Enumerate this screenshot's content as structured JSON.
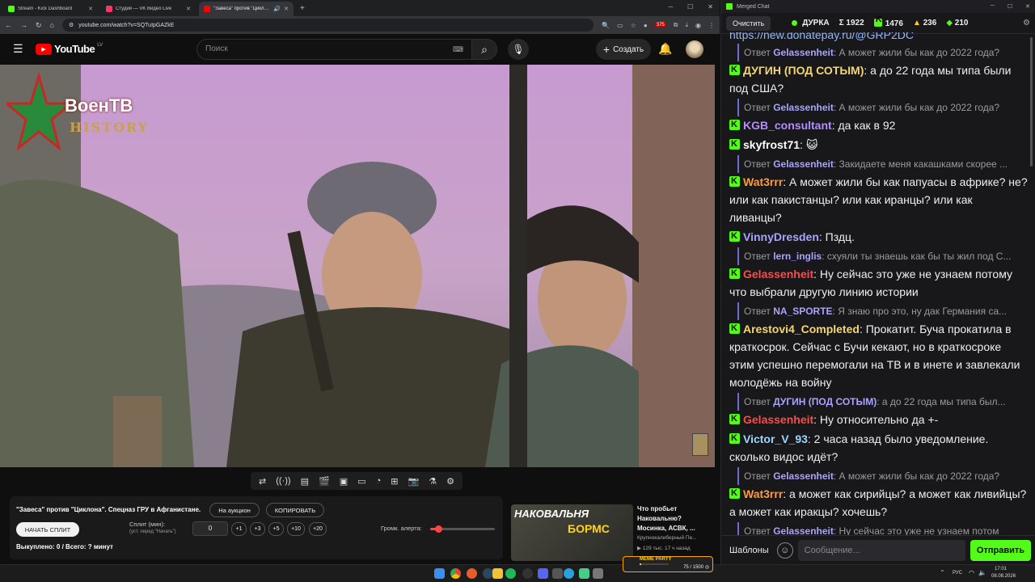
{
  "browser": {
    "tabs": [
      {
        "label": "Stream - Kick Dashboard",
        "color": "#53fc18"
      },
      {
        "label": "Студия — VK Видео Live",
        "color": "#ff3366"
      },
      {
        "label": "\"Завеса\" против \"Циклона\"...",
        "color": "#ff0000"
      }
    ],
    "url": "youtube.com/watch?v=SQTuIpGAZkE",
    "ext_badge": "375"
  },
  "youtube": {
    "logo": "YouTube",
    "region": "LV",
    "search_placeholder": "Поиск",
    "create_label": "Создать"
  },
  "video": {
    "watermark_line1": "ВоенТВ",
    "watermark_line2": "HISTORY"
  },
  "panel": {
    "title": "\"Завеса\" против \"Циклона\". Спецназ ГРУ в Афганистане.",
    "auction_label": "На аукцион",
    "copy_label": "КОПИРОВАТЬ",
    "start_split_label": "НАЧАТЬ СПЛИТ",
    "split_label": "Сплит (мин):",
    "split_hint": "(уст. перед \"Начать\")",
    "split_value": "0",
    "steps": [
      "+1",
      "+3",
      "+5",
      "+10",
      "+20"
    ],
    "alert_volume_label": "Громк. алерта:",
    "alert_volume": 0.12,
    "bought_label": "Выкуплено: 0 / Всего: ? минут"
  },
  "recommendation": {
    "thumb_text_1": "НАКОВАЛЬНЯ",
    "thumb_text_2": "БОРМС",
    "title": "Что пробьет Наковальню? Мосинка, АСВК, ...",
    "channel": "Крупнокалиберный Пе...",
    "meta": "▶ 129 тыс.   17 ч назад"
  },
  "taskbar": {
    "meme_label": "MEME PARTY",
    "meme_count": "75 / 1500 ◎",
    "lang": "РУС",
    "time": "17:01",
    "date": "08.08.2026"
  },
  "chat": {
    "window_title": "Merged Chat",
    "clear_label": "Очистить",
    "streamer": "ДУРКА",
    "stats": {
      "total": "Σ 1922",
      "kick": "1476",
      "other1": "236",
      "other2": "210"
    },
    "top_line": "https://new.donatepay.ru/@GRP2DC",
    "items": [
      {
        "type": "reply",
        "prefix": "Ответ",
        "user": "Gelassenheit",
        "text": ": А может жили бы как до 2022 года?"
      },
      {
        "type": "msg",
        "user": "ДУГИН (ПОД СОТЫМ)",
        "color": "#f5d76e",
        "text": ": а до 22 года мы типа были под США?"
      },
      {
        "type": "reply",
        "prefix": "Ответ",
        "user": "Gelassenheit",
        "text": ": А может жили бы как до 2022 года?"
      },
      {
        "type": "msg",
        "user": "KGB_consultant",
        "color": "#b48cff",
        "text": ": да как в 92"
      },
      {
        "type": "msg",
        "user": "skyfrost71",
        "color": "#ffffff",
        "text": ": 😺"
      },
      {
        "type": "reply",
        "prefix": "Ответ",
        "user": "Gelassenheit",
        "text": ": Закидаете меня какашками скорее ..."
      },
      {
        "type": "msg",
        "user": "Wat3rrr",
        "color": "#ff9a3c",
        "text": ": А может жили бы как папуасы в африке? не? или как пакистанцы? или как иранцы? или как ливанцы?"
      },
      {
        "type": "msg",
        "user": "VinnyDresden",
        "color": "#a9a4ff",
        "text": ": Пздц."
      },
      {
        "type": "reply",
        "prefix": "Ответ",
        "user": "lern_inglis",
        "text": ": схуяли ты знаешь как бы ты жил под С..."
      },
      {
        "type": "msg",
        "user": "Gelassenheit",
        "color": "#ff4a4a",
        "text": ": Ну сейчас это уже не узнаем потому что выбрали другую линию истории"
      },
      {
        "type": "reply",
        "prefix": "Ответ",
        "user": "NA_SPORTE",
        "text": ": Я знаю про это, ну дак Германия са..."
      },
      {
        "type": "msg",
        "user": "Arestovi4_Completed",
        "color": "#f5d76e",
        "text": ": Прокатит. Буча прокатила в краткосрок. Сейчас с Бучи кекают, но в краткосроке этим успешно перемогали на ТВ и в инете и завлекали молодёжь на войну"
      },
      {
        "type": "reply",
        "prefix": "Ответ",
        "user": "ДУГИН (ПОД СОТЫМ)",
        "text": ": а до 22 года мы типа был..."
      },
      {
        "type": "msg",
        "user": "Gelassenheit",
        "color": "#ff4a4a",
        "text": ": Ну относительно да +-"
      },
      {
        "type": "msg",
        "user": "Victor_V_93",
        "color": "#9ad6ff",
        "text": ": 2 часа назад было уведомление. сколько видос идёт?"
      },
      {
        "type": "reply",
        "prefix": "Ответ",
        "user": "Gelassenheit",
        "text": ": А может жили бы как до 2022 года?"
      },
      {
        "type": "msg",
        "user": "Wat3rrr",
        "color": "#ff9a3c",
        "text": ": а может как сирийцы? а может как ливийцы? а может как иракцы? хочешь?"
      },
      {
        "type": "reply",
        "prefix": "Ответ",
        "user": "Gelassenheit",
        "text": ": Ну сейчас это уже не узнаем потом"
      }
    ],
    "templates_label": "Шаблоны",
    "input_placeholder": "Сообщение...",
    "send_label": "Отправить"
  }
}
